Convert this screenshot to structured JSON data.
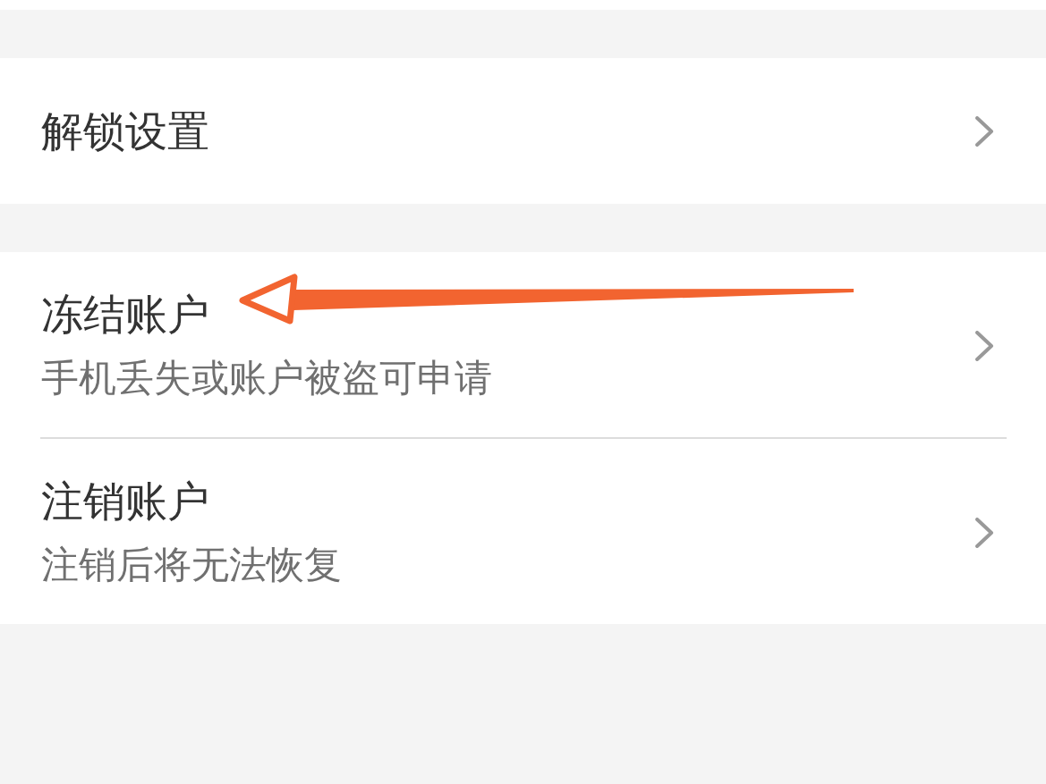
{
  "groups": [
    {
      "items": [
        {
          "title": "解锁设置",
          "annotated": false
        }
      ]
    },
    {
      "items": [
        {
          "title": "冻结账户",
          "subtitle": "手机丢失或账户被盗可申请",
          "annotated": true
        },
        {
          "title": "注销账户",
          "subtitle": "注销后将无法恢复",
          "annotated": false
        }
      ]
    }
  ]
}
